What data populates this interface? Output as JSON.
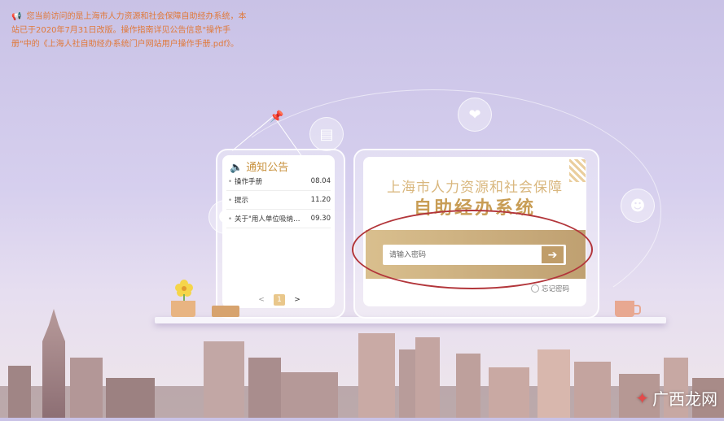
{
  "notice": {
    "icon": "megaphone-icon",
    "text": "您当前访问的是上海市人力资源和社会保障自助经办系统，本站已于2020年7月31日改版。操作指南详见公告信息\"操作手册\"中的《上海人社自助经办系统门户网站用户操作手册.pdf》。"
  },
  "noticeboard": {
    "title": "通知公告",
    "items": [
      {
        "title": "操作手册",
        "date": "08.04"
      },
      {
        "title": "提示",
        "date": "11.20"
      },
      {
        "title": "关于\"用人单位吸纳就业...",
        "date": "09.30"
      }
    ],
    "pager": {
      "prev": "<",
      "current": "1",
      "next": ">"
    }
  },
  "login": {
    "title": "上海市人力资源和社会保障",
    "subtitle": "自助经办系统",
    "password_placeholder": "请输入密码",
    "submit_icon": "arrow-right-icon",
    "forgot_label": "忘记密码"
  },
  "watermark": {
    "text": "广西龙网"
  },
  "colors": {
    "notice": "#e0793a",
    "gold": "#c89d55",
    "annotation_ring": "#b2353a"
  }
}
